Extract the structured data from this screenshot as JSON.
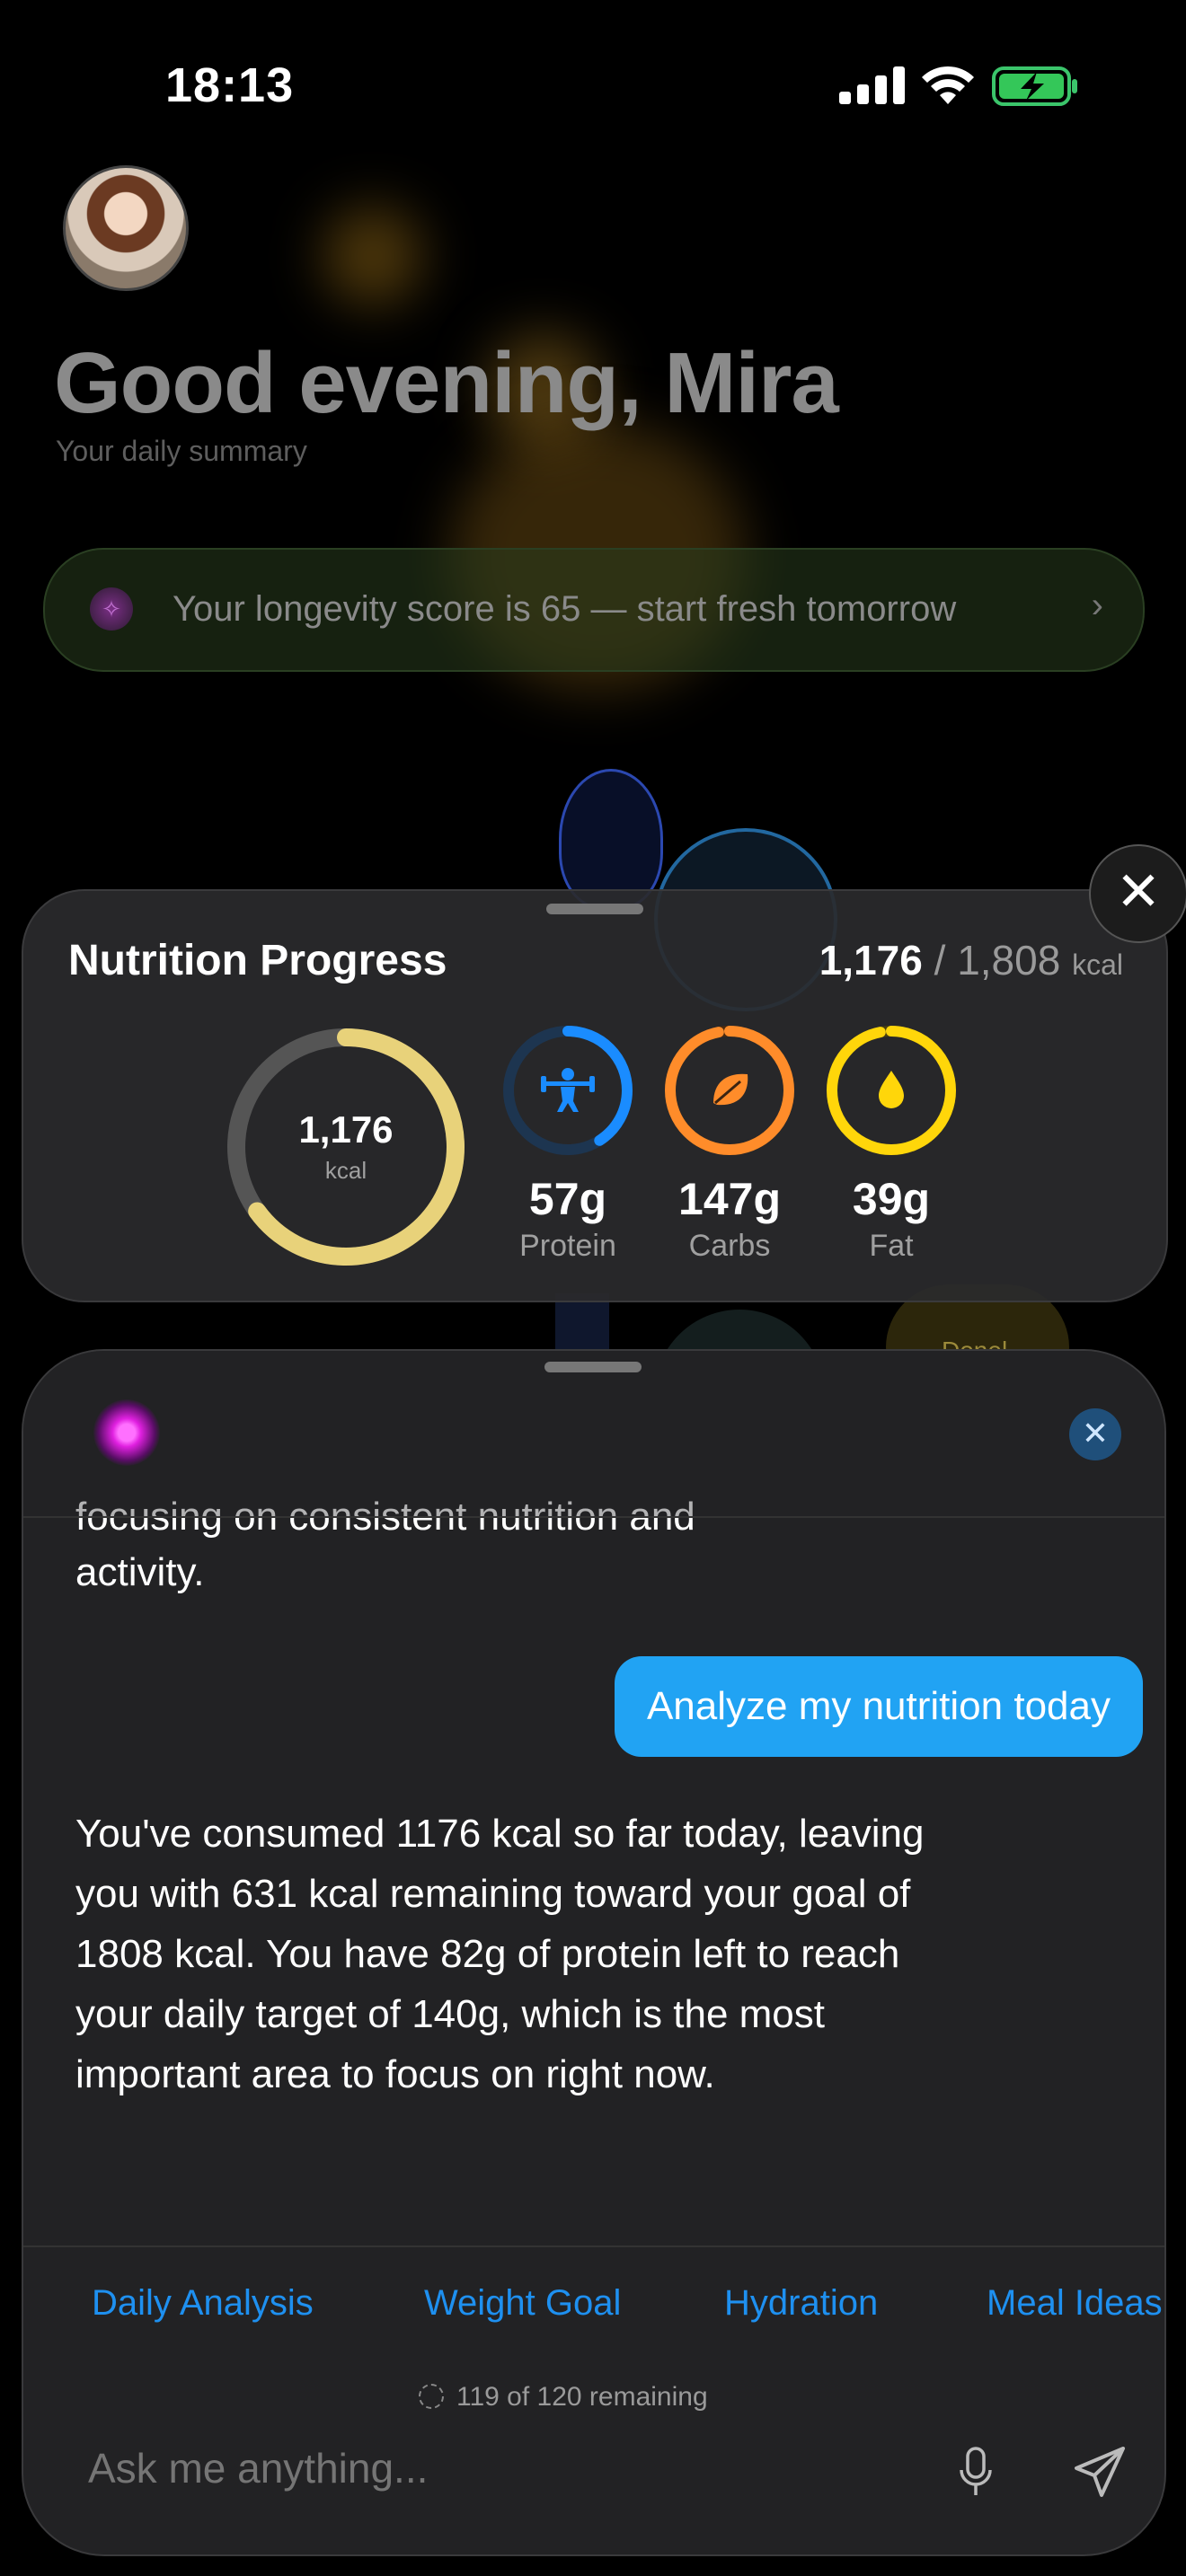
{
  "status_bar": {
    "time": "18:13"
  },
  "header": {
    "greeting": "Good evening, Mira",
    "subtitle": "Your daily summary",
    "score_banner": "Your longevity score is 65 — start fresh tomorrow"
  },
  "background": {
    "badge_label": "Donel"
  },
  "nutrition": {
    "title": "Nutrition Progress",
    "consumed": "1,176",
    "separator": "/",
    "goal": "1,808",
    "unit": "kcal",
    "ring_value": "1,176",
    "ring_unit": "kcal",
    "ring_progress": 0.65,
    "macros": [
      {
        "value": "57g",
        "label": "Protein",
        "color": "#1a8cff",
        "progress": 0.41,
        "icon": "weightlifter-icon"
      },
      {
        "value": "147g",
        "label": "Carbs",
        "color": "#ff8c2a",
        "progress": 0.97,
        "icon": "leaf-icon"
      },
      {
        "value": "39g",
        "label": "Fat",
        "color": "#ffd60a",
        "progress": 0.97,
        "icon": "drop-icon"
      }
    ],
    "colors": {
      "ring_main": "#e8d27a",
      "track": "#555555"
    }
  },
  "chat": {
    "previous_line_1": "focusing on consistent nutrition and",
    "previous_line_2": "activity.",
    "user_message": "Analyze my nutrition today",
    "ai_reply": "You've consumed 1176 kcal so far today, leaving you with 631 kcal remaining toward your goal of 1808 kcal. You have 82g of protein left to reach your daily target of 140g, which is the most important area to focus on right now.",
    "suggestions": [
      "Daily Analysis",
      "Weight Goal",
      "Hydration",
      "Meal Ideas"
    ],
    "quota": "119 of 120 remaining",
    "input_placeholder": "Ask me anything..."
  }
}
